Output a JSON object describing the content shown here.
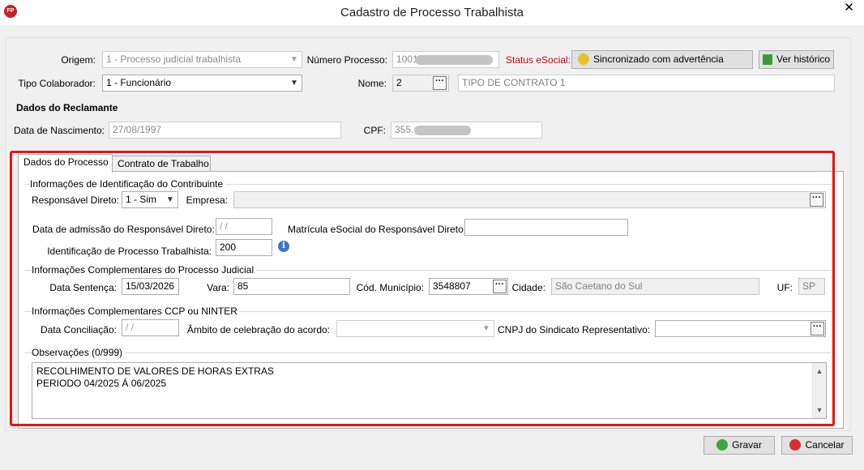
{
  "window": {
    "title": "Cadastro de Processo Trabalhista",
    "app_icon": "FP",
    "close": "✕"
  },
  "header": {
    "origem_label": "Origem:",
    "origem_value": "1 - Processo judicial trabalhista",
    "numero_label": "Número Processo:",
    "numero_value": "1001",
    "status_label": "Status eSocial:",
    "status_value": "Sincronizado com advertência",
    "historico_button": "Ver histórico",
    "tipo_label": "Tipo Colaborador:",
    "tipo_value": "1 - Funcionário",
    "nome_label": "Nome:",
    "nome_code": "2",
    "nome_value": "TIPO DE CONTRATO 1"
  },
  "reclamante": {
    "section_title": "Dados do Reclamante",
    "nascimento_label": "Data de Nascimento:",
    "nascimento_value": "27/08/1997",
    "cpf_label": "CPF:",
    "cpf_value": "355."
  },
  "tabs": [
    {
      "label": "Dados do Processo",
      "active": true
    },
    {
      "label": "Contrato de Trabalho",
      "active": false
    }
  ],
  "identificacao": {
    "group_title": "Informações de Identificação do Contribuinte",
    "responsavel_label": "Responsável Direto:",
    "responsavel_value": "1 - Sim",
    "empresa_label": "Empresa:",
    "empresa_value": "",
    "admissao_label": "Data de admissão do Responsável Direto:",
    "admissao_value": " / /",
    "matricula_label": "Matrícula eSocial do Responsável Direto",
    "matricula_value": "",
    "ident_label": "Identificação de Processo Trabalhista:",
    "ident_value": "200",
    "info_icon": "i"
  },
  "judicial": {
    "group_title": "Informações Complementares do Processo Judicial",
    "sentenca_label": "Data Sentença:",
    "sentenca_value": "15/03/2026",
    "vara_label": "Vara:",
    "vara_value": "85",
    "municipio_label": "Cód. Município:",
    "municipio_value": "3548807",
    "cidade_label": "Cidade:",
    "cidade_value": "São Caetano do Sul",
    "uf_label": "UF:",
    "uf_value": "SP"
  },
  "ccp": {
    "group_title": "Informações Complementares CCP ou NINTER",
    "conciliacao_label": "Data Conciliação:",
    "conciliacao_value": " / /",
    "ambito_label": "Âmbito de celebração do acordo:",
    "ambito_value": "",
    "cnpj_label": "CNPJ do Sindicato Representativo:",
    "cnpj_value": ""
  },
  "observacoes": {
    "group_title": "Observações (0/999)",
    "line1": "RECOLHIMENTO DE VALORES DE HORAS EXTRAS",
    "line2": "PERIODO 04/2025 Á 06/2025"
  },
  "footer": {
    "save": "Gravar",
    "cancel": "Cancelar"
  },
  "colors": {
    "highlight_frame": "#ee1111",
    "status_red": "#d40000",
    "save_icon": "#3aa83a",
    "cancel_icon": "#d83030"
  }
}
